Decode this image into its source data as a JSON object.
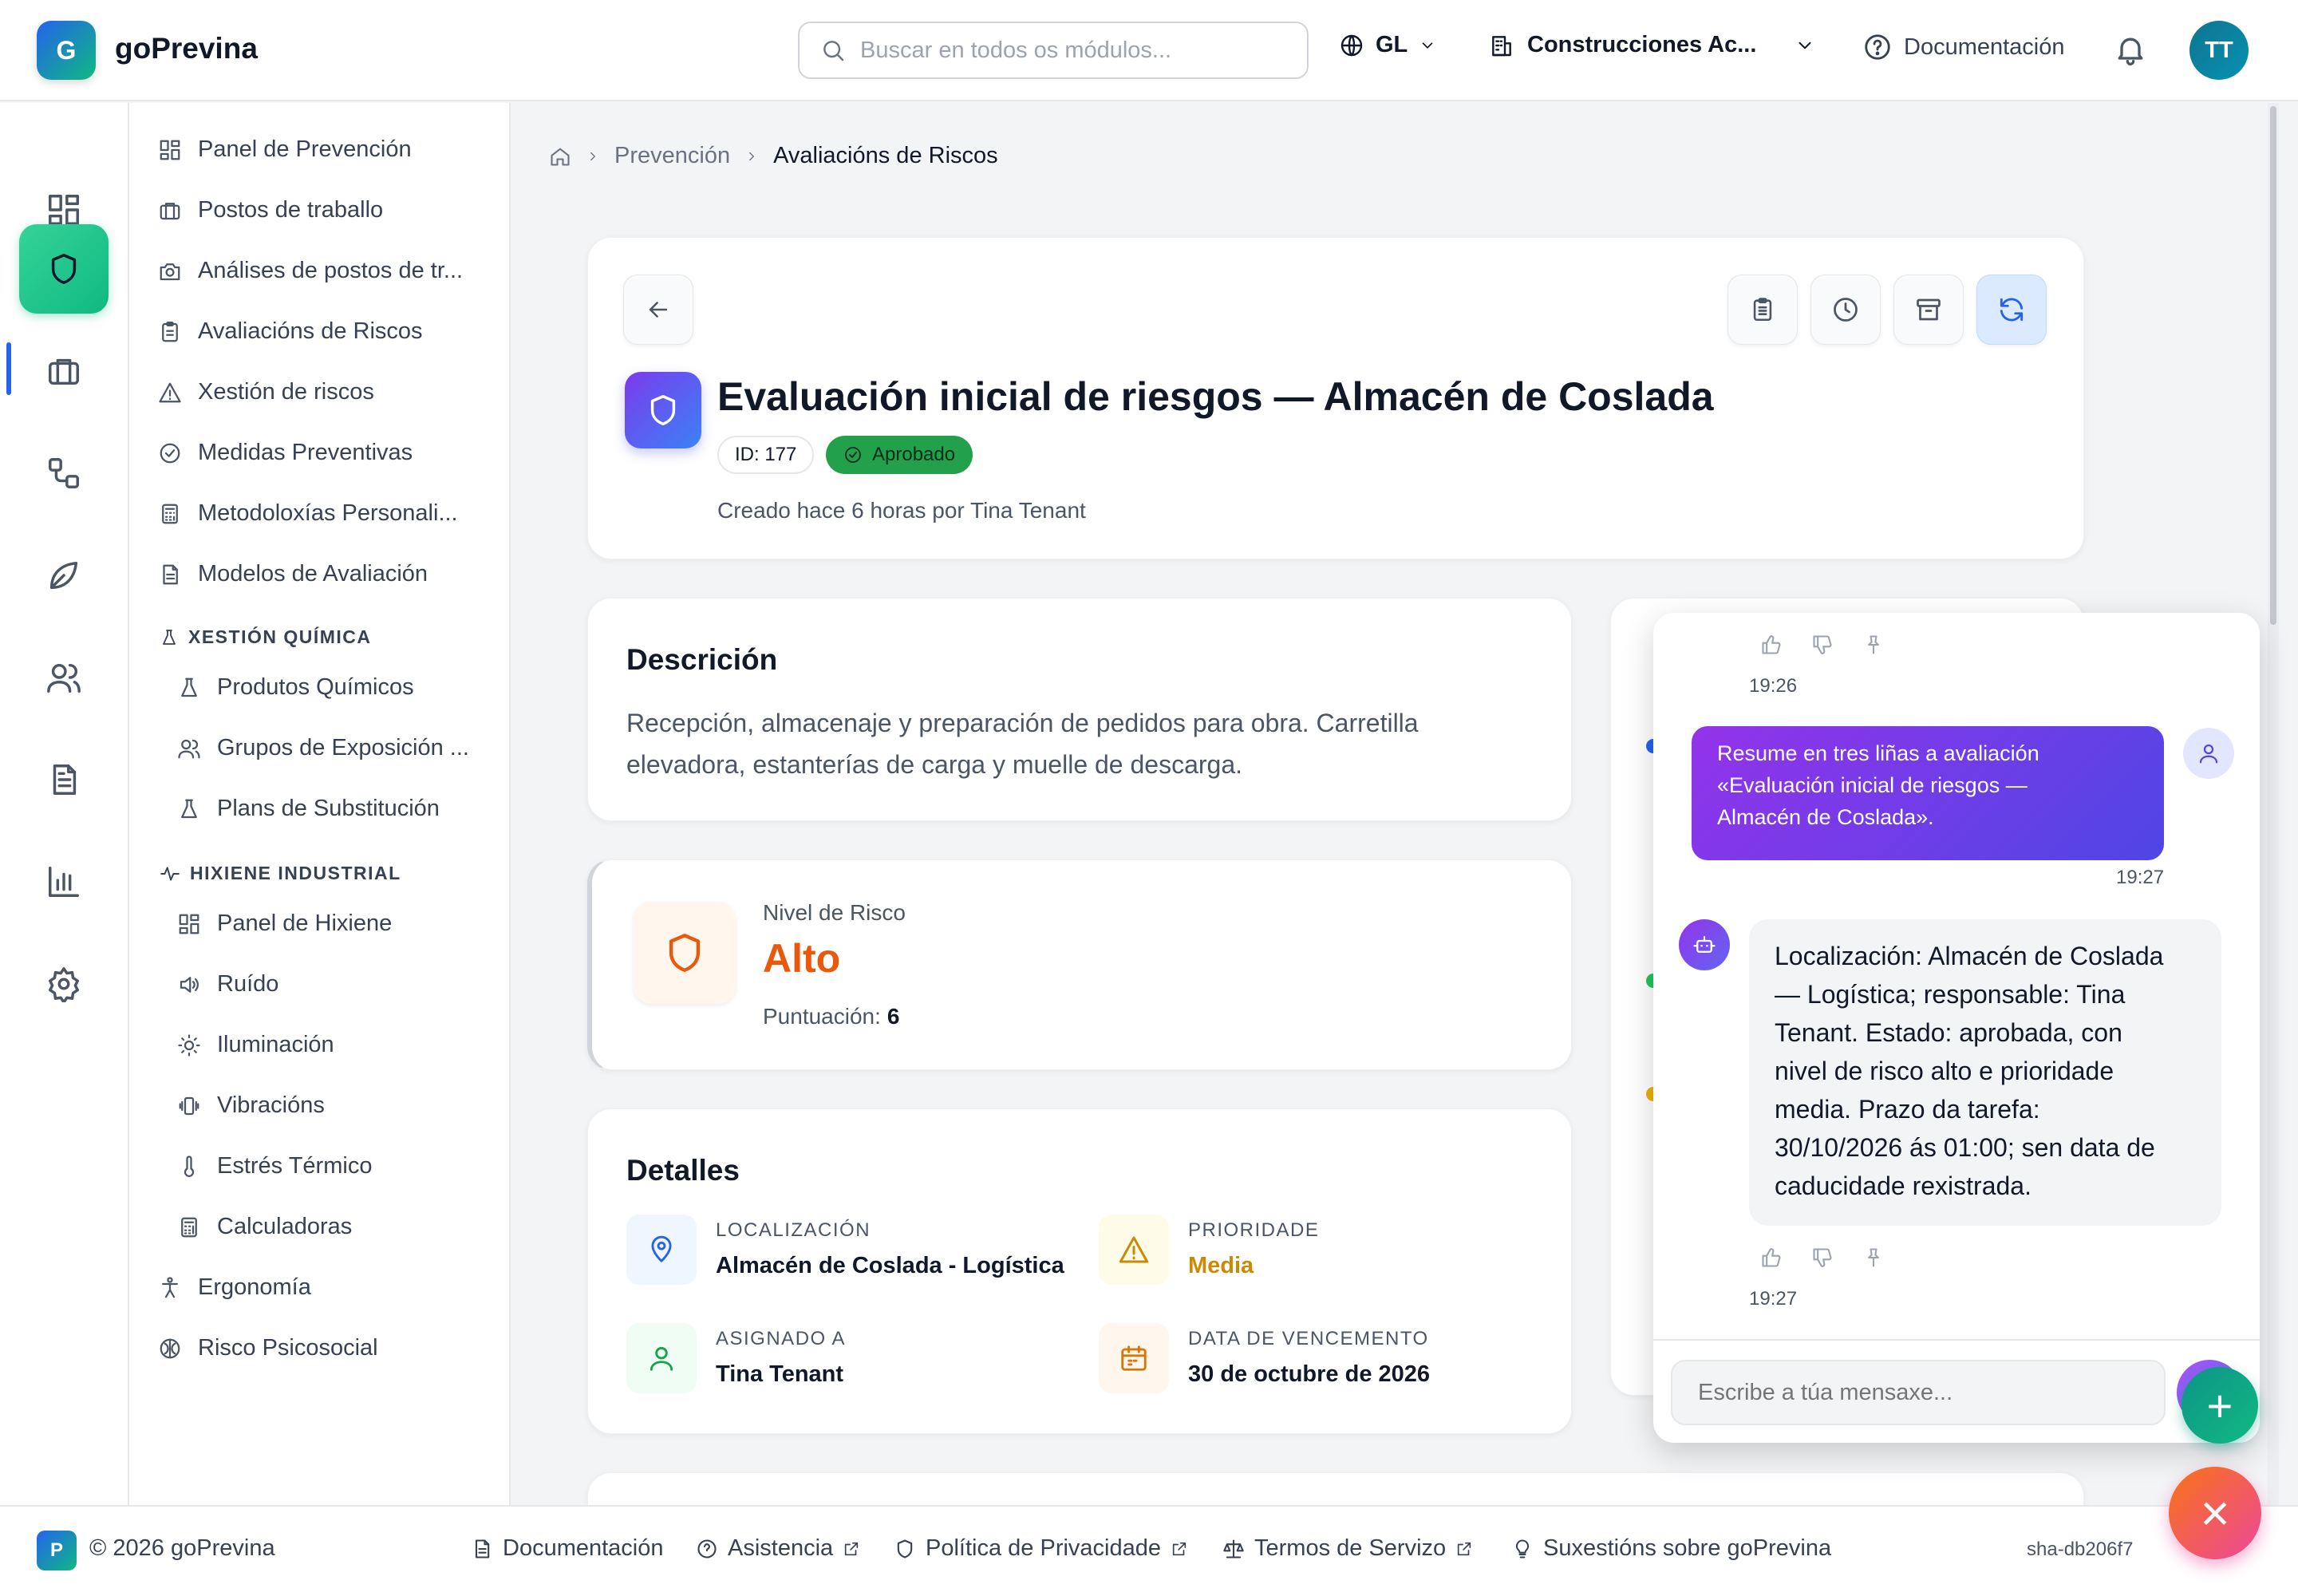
{
  "header": {
    "logo_letter": "G",
    "app_name": "goPrevina",
    "search_placeholder": "Buscar en todos os módulos...",
    "language": "GL",
    "company": "Construcciones Ac...",
    "docs_label": "Documentación",
    "avatar_initials": "TT"
  },
  "sidebar": {
    "items": [
      {
        "label": "Panel de Prevención",
        "icon": "dashboard-icon"
      },
      {
        "label": "Postos de traballo",
        "icon": "briefcase-icon"
      },
      {
        "label": "Análises de postos de tr...",
        "icon": "camera-icon"
      },
      {
        "label": "Avaliacións de Riscos",
        "icon": "clipboard-icon"
      },
      {
        "label": "Xestión de riscos",
        "icon": "warning-icon"
      },
      {
        "label": "Medidas Preventivas",
        "icon": "check-circle-icon"
      },
      {
        "label": "Metodoloxías Personali...",
        "icon": "calculator-icon"
      },
      {
        "label": "Modelos de Avaliación",
        "icon": "document-icon"
      }
    ],
    "chem_section": "XESTIÓN QUÍMICA",
    "chem_items": [
      {
        "label": "Produtos Químicos",
        "icon": "flask-icon"
      },
      {
        "label": "Grupos de Exposición ...",
        "icon": "users-icon"
      },
      {
        "label": "Plans de Substitución",
        "icon": "flask-icon"
      }
    ],
    "hyg_section": "HIXIENE INDUSTRIAL",
    "hyg_items": [
      {
        "label": "Panel de Hixiene",
        "icon": "dashboard-icon"
      },
      {
        "label": "Ruído",
        "icon": "speaker-icon"
      },
      {
        "label": "Iluminación",
        "icon": "sun-icon"
      },
      {
        "label": "Vibracións",
        "icon": "vibration-icon"
      },
      {
        "label": "Estrés Térmico",
        "icon": "thermometer-icon"
      },
      {
        "label": "Calculadoras",
        "icon": "calculator-icon"
      }
    ],
    "bottom_items": [
      {
        "label": "Ergonomía",
        "icon": "person-icon"
      },
      {
        "label": "Risco Psicosocial",
        "icon": "brain-icon"
      }
    ]
  },
  "breadcrumb": {
    "home_icon": "home-icon",
    "level1": "Prevención",
    "current": "Avaliacións de Riscos"
  },
  "evaluation": {
    "title": "Evaluación inicial de riesgos — Almacén de Coslada",
    "id_badge": "ID: 177",
    "status": "Aprobado",
    "created": "Creado hace 6 horas por Tina Tenant"
  },
  "description": {
    "heading": "Descrición",
    "text_line1": "Recepción, almacenaje y preparación de pedidos para obra. Carretilla",
    "text_line2": "elevadora, estanterías de carga y muelle de descarga."
  },
  "risk": {
    "label": "Nivel de Risco",
    "level": "Alto",
    "score_label": "Puntuación:",
    "score": "6"
  },
  "details": {
    "heading": "Detalles",
    "location_label": "LOCALIZACIÓN",
    "location": "Almacén de Coslada - Logística",
    "priority_label": "PRIORIDADE",
    "priority": "Media",
    "assigned_label": "ASIGNADO A",
    "assigned": "Tina Tenant",
    "due_label": "DATA DE VENCEMENTO",
    "due": "30 de octubre de 2026"
  },
  "chat": {
    "time1": "19:26",
    "user_message": "Resume en tres liñas a avaliación «Evaluación inicial de riesgos — Almacén de Coslada».",
    "user_lines": [
      "Resume en tres liñas a avaliación",
      "«Evaluación inicial de riesgos —",
      "Almacén de Coslada»."
    ],
    "time2": "19:27",
    "bot_lines": [
      "Localización: Almacén de Coslada",
      "— Logística; responsable: Tina",
      "Tenant. Estado: aprobada, con",
      "nivel de risco alto e prioridade",
      "media. Prazo da tarefa:",
      "30/10/2026 ás 01:00; sen data de",
      "caducidade rexistrada."
    ],
    "time3": "19:27",
    "input_placeholder": "Escribe a túa mensaxe...",
    "add_symbol": "+",
    "close_symbol": "×"
  },
  "footer": {
    "logo_letter": "P",
    "copyright": "© 2026 goPrevina",
    "docs": "Documentación",
    "support": "Asistencia",
    "privacy": "Política de Privacidade",
    "terms": "Termos de Servizo",
    "suggestions": "Suxestións sobre goPrevina",
    "version": "sha-db206f7"
  },
  "colors": {
    "accent_blue": "#2563eb",
    "brand_green": "#10b981",
    "risk_orange": "#ea580c",
    "priority_amber": "#ca8a04",
    "approved_green": "#22a04b",
    "chat_gradient_start": "#9333ea",
    "chat_gradient_end": "#4f46e5"
  }
}
